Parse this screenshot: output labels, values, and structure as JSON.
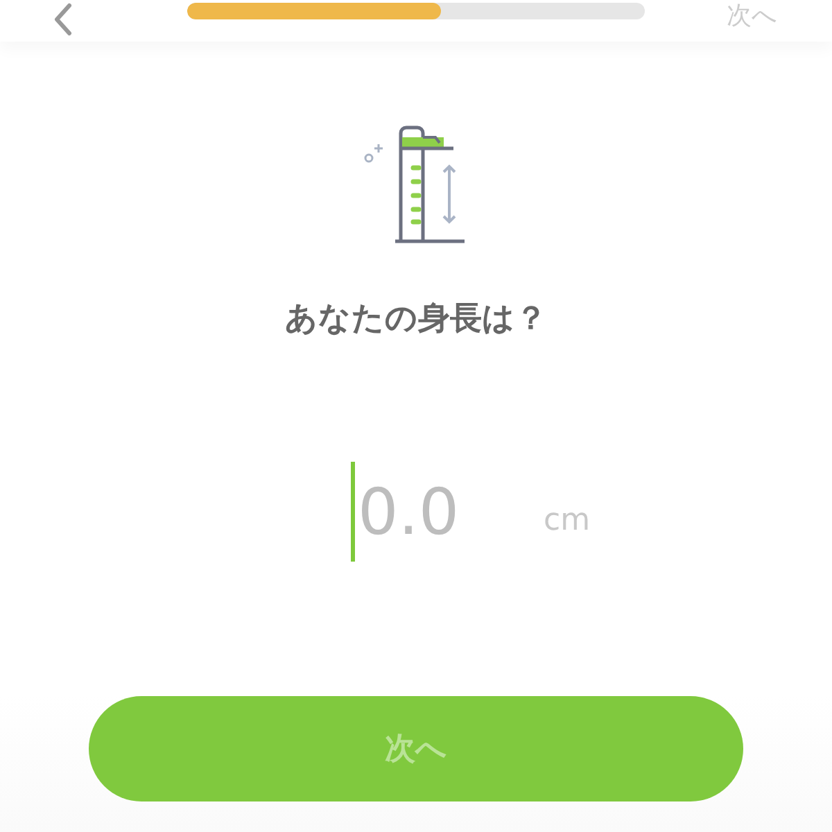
{
  "header": {
    "progress": {
      "level": 0.555
    },
    "next": "次へ"
  },
  "question": "あなたの身長は？",
  "height_field": {
    "placeholder": "0.0",
    "unit": "cm"
  },
  "button": {
    "label": "次へ"
  }
}
